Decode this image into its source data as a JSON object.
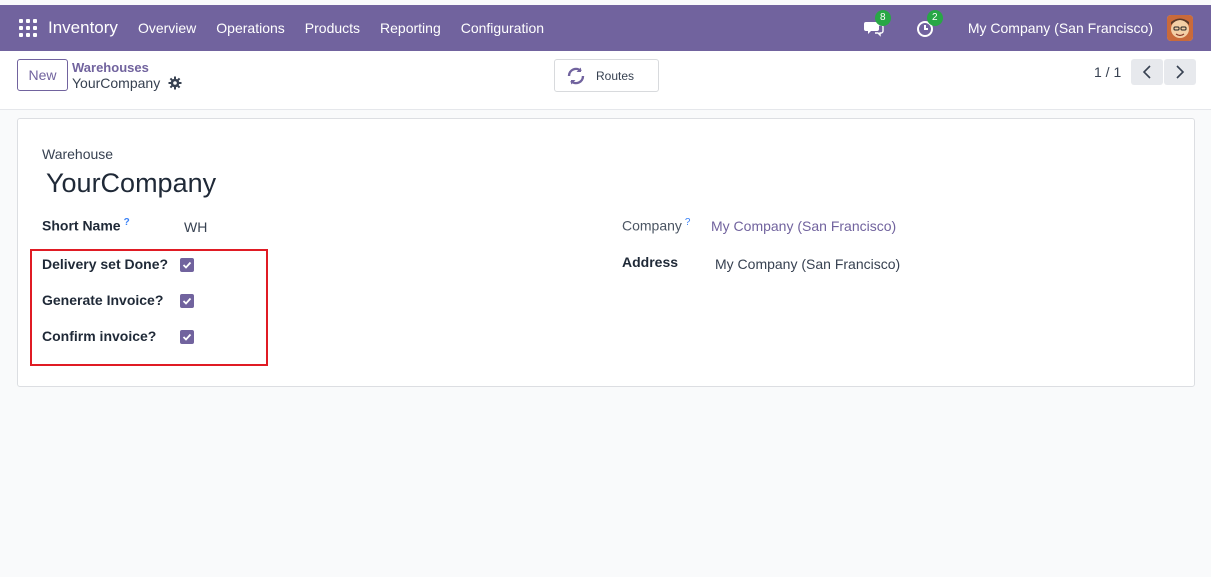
{
  "navbar": {
    "app_title": "Inventory",
    "menu": [
      "Overview",
      "Operations",
      "Products",
      "Reporting",
      "Configuration"
    ],
    "messages_badge": "8",
    "activities_badge": "2",
    "company": "My Company (San Francisco)"
  },
  "control_panel": {
    "new_label": "New",
    "breadcrumb_parent": "Warehouses",
    "breadcrumb_current": "YourCompany",
    "routes_label": "Routes",
    "pager": "1 / 1"
  },
  "form": {
    "warehouse_label": "Warehouse",
    "name": "YourCompany",
    "short_name_label": "Short Name",
    "short_name_value": "WH",
    "company_label": "Company",
    "company_value": "My Company (San Francisco)",
    "address_label": "Address",
    "address_value": "My Company (San Francisco)",
    "help_mark": "?",
    "checkboxes": [
      {
        "label": "Delivery set Done?",
        "checked": true
      },
      {
        "label": "Generate Invoice?",
        "checked": true
      },
      {
        "label": "Confirm invoice?",
        "checked": true
      }
    ]
  },
  "colors": {
    "brand": "#71639e",
    "badge": "#28a745",
    "highlight": "#e01b24"
  }
}
